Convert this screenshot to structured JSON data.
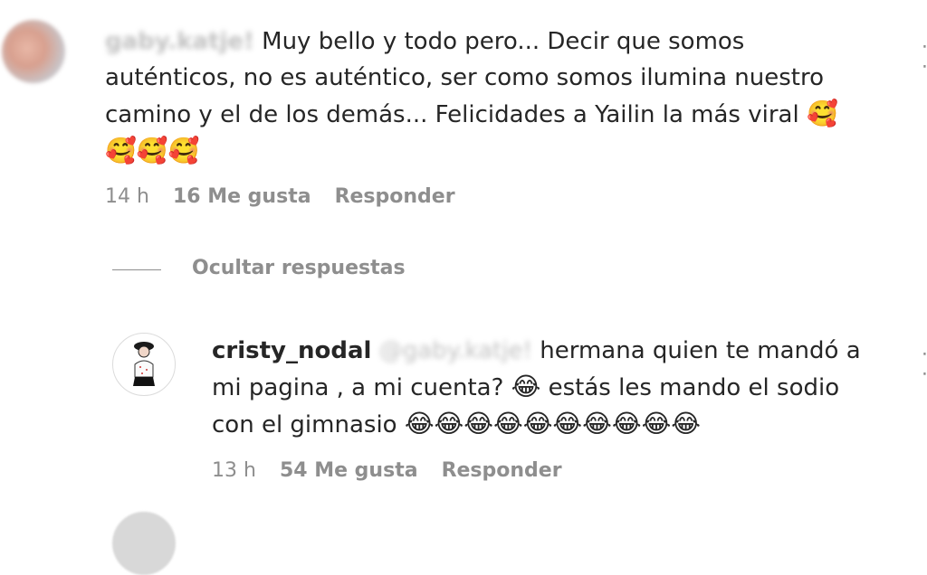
{
  "comments": [
    {
      "username_hidden": "gaby.katje!",
      "text_line1": "Muy bello y todo pero... Decir que somos",
      "text_line2": "auténticos, no es auténtico, ser como somos ilumina nuestro",
      "text_line3": "camino y el de los demás... Felicidades a Yailin la más viral",
      "emoji_end": "🥰",
      "emoji_line": "🥰🥰🥰",
      "time": "14 h",
      "likes": "16 Me gusta",
      "reply_label": "Responder"
    },
    {
      "username": "cristy_nodal",
      "mention_hidden": "@gaby.katje!",
      "text_line1": "hermana quien te mandó a",
      "text_line2": "mi pagina , a mi cuenta?",
      "emoji_mid": "😂",
      "text_line2b": "estás les mando el sodio",
      "text_line3": "con el gimnasio",
      "emoji_line": "😂😂😂😂😂😂😂😂😂😂",
      "time": "13 h",
      "likes": "54 Me gusta",
      "reply_label": "Responder"
    }
  ],
  "replies": {
    "toggle_label": "Ocultar respuestas"
  },
  "icons": {
    "more": "more-options-icon",
    "avatar": "avatar-icon"
  }
}
